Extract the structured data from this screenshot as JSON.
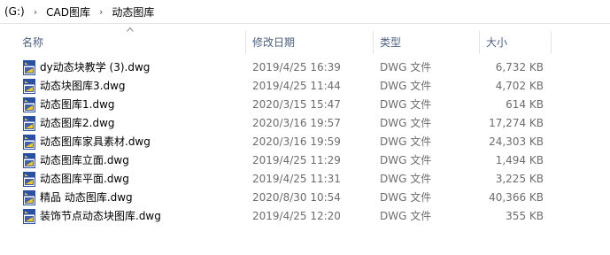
{
  "breadcrumb": {
    "items": [
      "(G:)",
      "CAD图库",
      "动态图库"
    ],
    "separator": "›"
  },
  "columns": {
    "name": "名称",
    "date": "修改日期",
    "type": "类型",
    "size": "大小"
  },
  "sort": {
    "column": "name",
    "direction": "ascending"
  },
  "icon": {
    "name": "dwg-file-icon",
    "color_main": "#2b4fa3",
    "color_accent": "#f2c81e"
  },
  "files": [
    {
      "name": "dy动态块教学 (3).dwg",
      "date": "2019/4/25 16:39",
      "type": "DWG 文件",
      "size": "6,732 KB"
    },
    {
      "name": "动态块图库3.dwg",
      "date": "2019/4/25 11:44",
      "type": "DWG 文件",
      "size": "4,702 KB"
    },
    {
      "name": "动态图库1.dwg",
      "date": "2020/3/15 15:47",
      "type": "DWG 文件",
      "size": "614 KB"
    },
    {
      "name": "动态图库2.dwg",
      "date": "2020/3/16 19:57",
      "type": "DWG 文件",
      "size": "17,274 KB"
    },
    {
      "name": "动态图库家具素材.dwg",
      "date": "2020/3/16 19:59",
      "type": "DWG 文件",
      "size": "24,303 KB"
    },
    {
      "name": "动态图库立面.dwg",
      "date": "2019/4/25 11:29",
      "type": "DWG 文件",
      "size": "1,494 KB"
    },
    {
      "name": "动态图库平面.dwg",
      "date": "2019/4/25 11:31",
      "type": "DWG 文件",
      "size": "3,225 KB"
    },
    {
      "name": "精品 动态图库.dwg",
      "date": "2020/8/30 10:54",
      "type": "DWG 文件",
      "size": "40,366 KB"
    },
    {
      "name": "装饰节点动态块图库.dwg",
      "date": "2019/4/25 12:20",
      "type": "DWG 文件",
      "size": "355 KB"
    }
  ]
}
